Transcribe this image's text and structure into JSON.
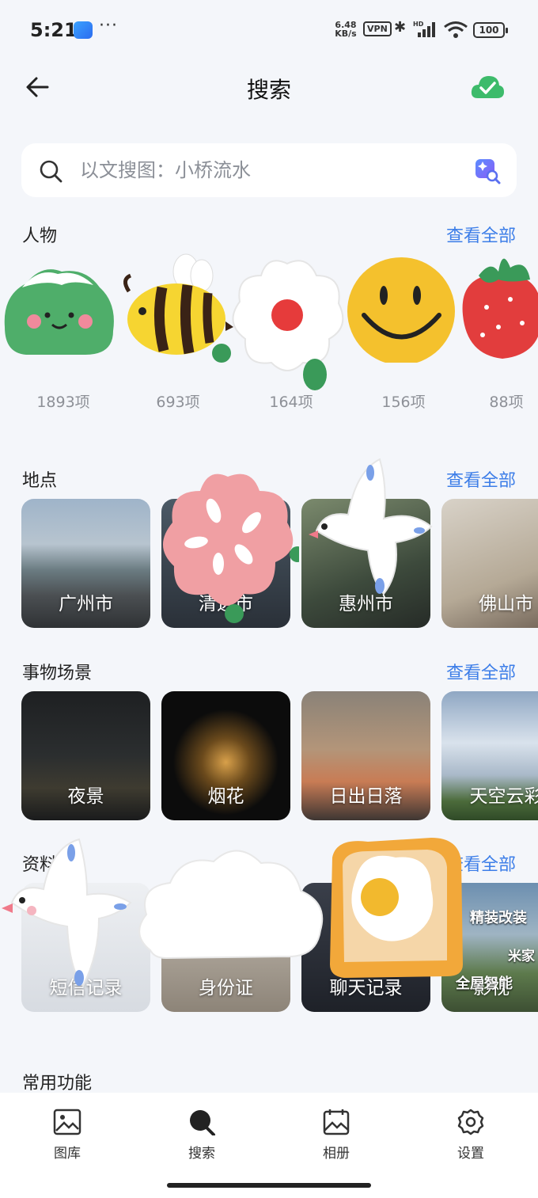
{
  "status": {
    "time": "5:21",
    "net_speed": "6.48\nKB/s",
    "vpn": "VPN",
    "battery": "100"
  },
  "header": {
    "title": "搜索"
  },
  "search": {
    "placeholder": "以文搜图：小桥流水"
  },
  "people": {
    "title": "人物",
    "see_all": "查看全部",
    "items": [
      {
        "count": "1893项"
      },
      {
        "count": "693项"
      },
      {
        "count": "164项"
      },
      {
        "count": "156项"
      },
      {
        "count": "88项"
      }
    ]
  },
  "places": {
    "title": "地点",
    "see_all": "查看全部",
    "items": [
      {
        "label": "广州市"
      },
      {
        "label": "清远市"
      },
      {
        "label": "惠州市"
      },
      {
        "label": "佛山市"
      }
    ]
  },
  "scenes": {
    "title": "事物场景",
    "see_all": "查看全部",
    "items": [
      {
        "label": "夜景"
      },
      {
        "label": "烟花"
      },
      {
        "label": "日出日落"
      },
      {
        "label": "天空云彩"
      }
    ]
  },
  "documents": {
    "title": "资料",
    "see_all": "查看全部",
    "items": [
      {
        "label": "短信记录"
      },
      {
        "label": "身份证"
      },
      {
        "label": "聊天记录"
      },
      {
        "label": "影视"
      }
    ],
    "photo_text": [
      "精装改装",
      "米家",
      "全屋智能"
    ]
  },
  "common": {
    "title": "常用功能"
  },
  "tabs": [
    {
      "label": "图库"
    },
    {
      "label": "搜索"
    },
    {
      "label": "相册"
    },
    {
      "label": "设置"
    }
  ],
  "colors": {
    "accent": "#3d7ee8",
    "background": "#f4f6fa",
    "sync_ok": "#3dbb6b"
  }
}
